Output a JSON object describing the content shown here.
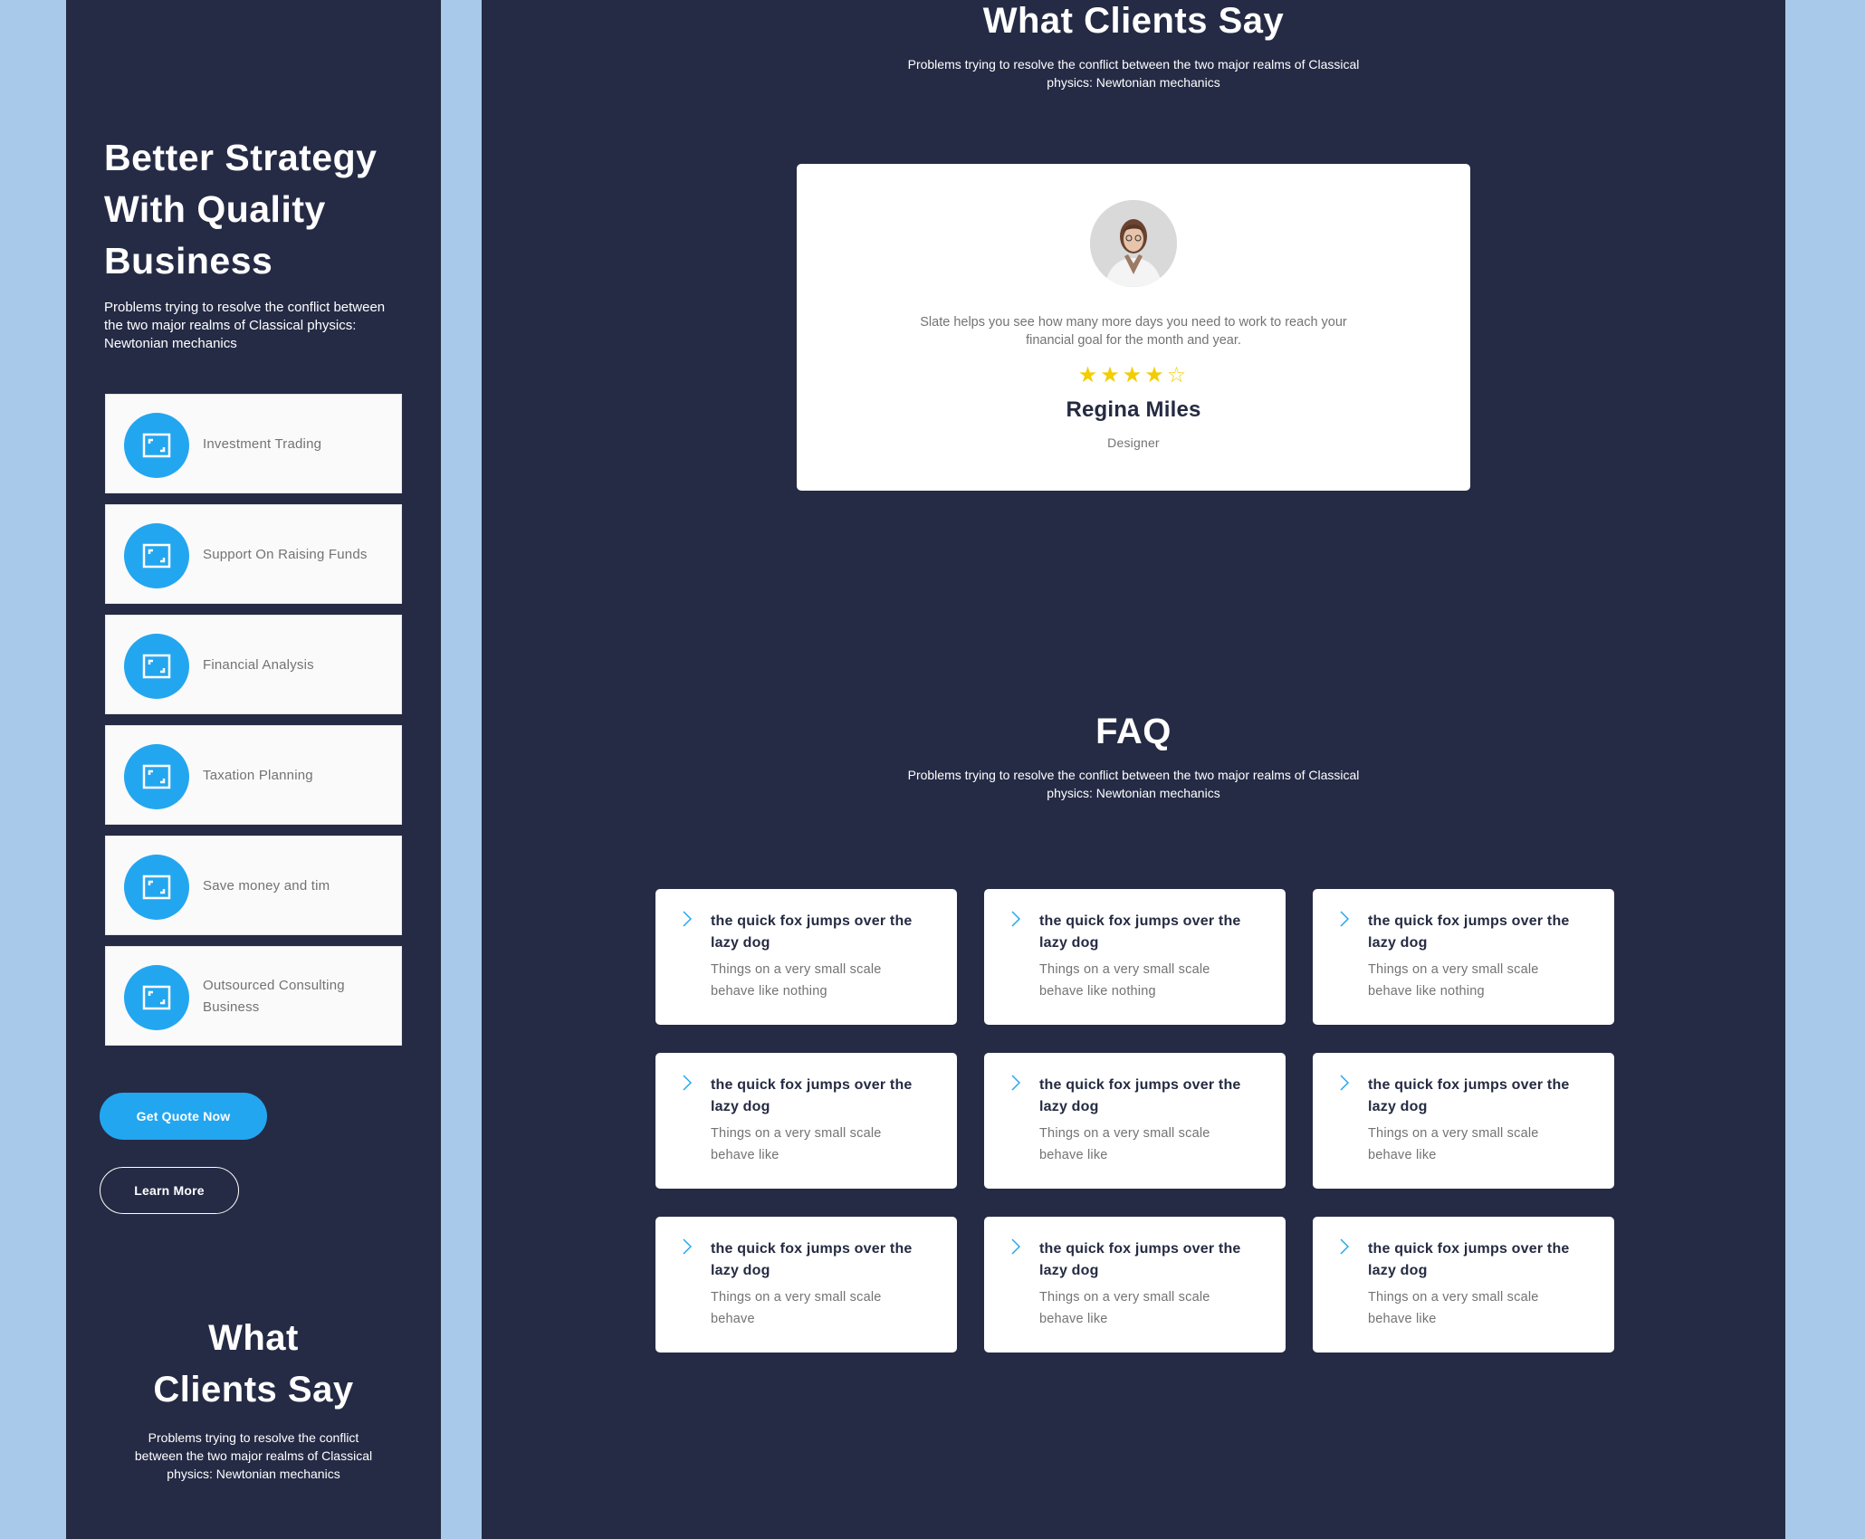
{
  "left": {
    "hero_title": "Better Strategy With Quality Business",
    "hero_desc": "Problems trying to resolve the conflict between the two major realms of Classical physics: Newtonian mechanics",
    "services": [
      {
        "label": "Investment Trading",
        "icon": "image-icon"
      },
      {
        "label": "Support On Raising Funds",
        "icon": "image-icon"
      },
      {
        "label": "Financial Analysis",
        "icon": "image-icon"
      },
      {
        "label": "Taxation Planning",
        "icon": "image-icon"
      },
      {
        "label": "Save money and tim",
        "icon": "image-icon"
      },
      {
        "label": "Outsourced Consulting Business",
        "icon": "image-icon"
      }
    ],
    "quote_button": "Get Quote Now",
    "learn_button": "Learn More",
    "clients_title": "What Clients Say",
    "clients_desc": "Problems trying to resolve the conflict between the two major realms of Classical physics: Newtonian mechanics"
  },
  "testimonials": {
    "title": "What Clients Say",
    "desc": "Problems trying to resolve the conflict between the two major realms of Classical physics: Newtonian mechanics",
    "quote": "Slate helps you see how many more days you need to work to reach your financial goal for the month and year.",
    "rating": 4,
    "rating_max": 5,
    "name": "Regina Miles",
    "role": "Designer"
  },
  "faq": {
    "title": "FAQ",
    "desc": "Problems trying to resolve the conflict between the two major realms of Classical physics: Newtonian mechanics",
    "items": [
      {
        "q": "the quick fox jumps over the lazy dog",
        "a": "Things on a very small scale behave like nothing"
      },
      {
        "q": "the quick fox jumps over the lazy dog",
        "a": "Things on a very small scale behave like nothing"
      },
      {
        "q": "the quick fox jumps over the lazy dog",
        "a": "Things on a very small scale behave like nothing"
      },
      {
        "q": "the quick fox jumps over the lazy dog",
        "a": "Things on a very small scale behave like"
      },
      {
        "q": "the quick fox jumps over the lazy dog",
        "a": "Things on a very small scale behave like"
      },
      {
        "q": "the quick fox jumps over the lazy dog",
        "a": "Things on a very small scale behave like"
      },
      {
        "q": "the quick fox jumps over the lazy dog",
        "a": "Things on a very small scale behave"
      },
      {
        "q": "the quick fox jumps over the lazy dog",
        "a": "Things on a very small scale behave like"
      },
      {
        "q": "the quick fox jumps over the lazy dog",
        "a": "Things on a very small scale behave like"
      }
    ]
  },
  "colors": {
    "background": "#a9c9ea",
    "panel": "#252b45",
    "accent": "#23a6f0",
    "star": "#f3cd03"
  }
}
